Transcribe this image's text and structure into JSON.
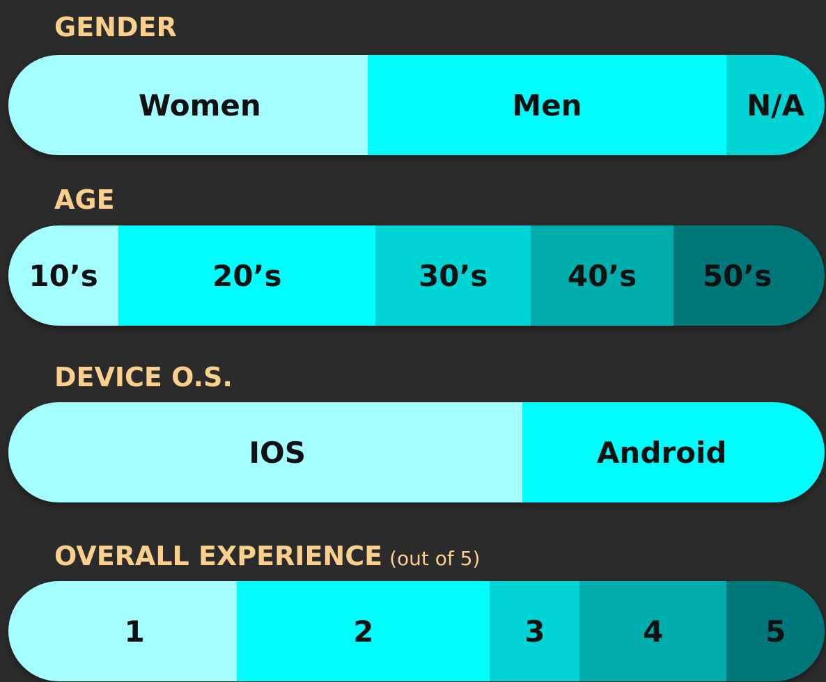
{
  "colors": {
    "background": "#2b2b2b",
    "title": "#fbd08c",
    "shade1": "#a4fdfe",
    "shade2": "#00fdfe",
    "shade3": "#00d4d4",
    "shade4": "#00adad",
    "shade5": "#007879"
  },
  "chart_data": [
    {
      "type": "bar",
      "title": "GENDER",
      "stacked": true,
      "categories": [
        "Women",
        "Men",
        "N/A"
      ],
      "values": [
        44,
        44,
        12
      ],
      "unit": "% of width (estimated)"
    },
    {
      "type": "bar",
      "title": "AGE",
      "stacked": true,
      "categories": [
        "10’s",
        "20’s",
        "30’s",
        "40’s",
        "50’s"
      ],
      "values": [
        13.5,
        31.5,
        19,
        17.5,
        18.5
      ],
      "unit": "% of width (estimated)"
    },
    {
      "type": "bar",
      "title": "DEVICE O.S.",
      "stacked": true,
      "categories": [
        "IOS",
        "Android"
      ],
      "values": [
        63,
        37
      ],
      "unit": "% of width (estimated)"
    },
    {
      "type": "bar",
      "title": "OVERALL EXPERIENCE",
      "subtitle": "(out of 5)",
      "stacked": true,
      "categories": [
        "1",
        "2",
        "3",
        "4",
        "5"
      ],
      "values": [
        28,
        31,
        11,
        18,
        12
      ],
      "unit": "% of width (estimated)"
    }
  ]
}
